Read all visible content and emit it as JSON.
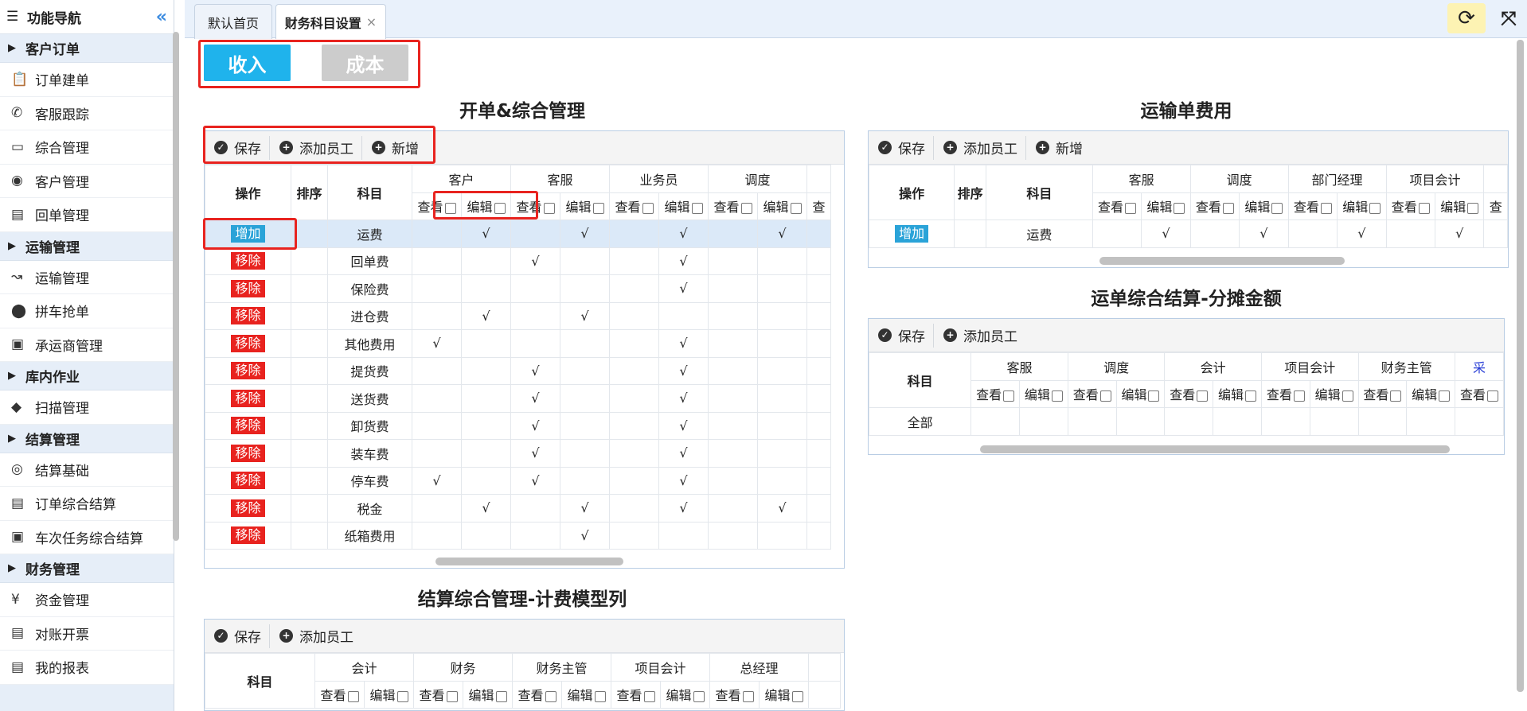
{
  "sidebar": {
    "title": "功能导航",
    "collapse_icon": "double-chevron-left-icon",
    "groups": [
      {
        "label": "客户订单",
        "items": [
          {
            "label": "订单建单",
            "icon": "clipboard-icon"
          },
          {
            "label": "客服跟踪",
            "icon": "phone-icon"
          },
          {
            "label": "综合管理",
            "icon": "monitor-icon"
          },
          {
            "label": "客户管理",
            "icon": "user-circle-icon"
          },
          {
            "label": "回单管理",
            "icon": "document-icon"
          }
        ]
      },
      {
        "label": "运输管理",
        "items": [
          {
            "label": "运输管理",
            "icon": "route-icon"
          },
          {
            "label": "拼车抢单",
            "icon": "map-pin-icon"
          },
          {
            "label": "承运商管理",
            "icon": "bus-icon"
          }
        ]
      },
      {
        "label": "库内作业",
        "items": [
          {
            "label": "扫描管理",
            "icon": "box-icon"
          }
        ]
      },
      {
        "label": "结算管理",
        "items": [
          {
            "label": "结算基础",
            "icon": "eye-icon"
          },
          {
            "label": "订单综合结算",
            "icon": "document-icon"
          },
          {
            "label": "车次任务综合结算",
            "icon": "bus-icon"
          }
        ]
      },
      {
        "label": "财务管理",
        "items": [
          {
            "label": "资金管理",
            "icon": "yen-icon"
          },
          {
            "label": "对账开票",
            "icon": "document-icon"
          },
          {
            "label": "我的报表",
            "icon": "document-icon"
          }
        ]
      }
    ]
  },
  "tabs": [
    {
      "label": "默认首页",
      "active": false
    },
    {
      "label": "财务科目设置",
      "active": true,
      "close": "×"
    }
  ],
  "toggle": {
    "income": "收入",
    "cost": "成本",
    "income_color": "#1fb3ec",
    "cost_color": "#cccccc"
  },
  "common": {
    "save": "保存",
    "add_staff": "添加员工",
    "add_new": "新增",
    "view": "查看",
    "edit": "编辑",
    "op": "操作",
    "order": "排序",
    "subject": "科目",
    "add": "增加",
    "remove": "移除",
    "check": "√"
  },
  "sec1": {
    "title": "开单&综合管理",
    "roles": [
      "客户",
      "客服",
      "业务员",
      "调度"
    ],
    "rows": [
      {
        "name": "运费",
        "cells": [
          0,
          1,
          0,
          1,
          0,
          1,
          0,
          1
        ],
        "add": true
      },
      {
        "name": "回单费",
        "cells": [
          0,
          0,
          1,
          0,
          0,
          1,
          0,
          0
        ]
      },
      {
        "name": "保险费",
        "cells": [
          0,
          0,
          0,
          0,
          0,
          1,
          0,
          0
        ]
      },
      {
        "name": "进仓费",
        "cells": [
          0,
          1,
          0,
          1,
          0,
          0,
          0,
          0
        ]
      },
      {
        "name": "其他费用",
        "cells": [
          1,
          0,
          0,
          0,
          0,
          1,
          0,
          0
        ]
      },
      {
        "name": "提货费",
        "cells": [
          0,
          0,
          1,
          0,
          0,
          1,
          0,
          0
        ]
      },
      {
        "name": "送货费",
        "cells": [
          0,
          0,
          1,
          0,
          0,
          1,
          0,
          0
        ]
      },
      {
        "name": "卸货费",
        "cells": [
          0,
          0,
          1,
          0,
          0,
          1,
          0,
          0
        ]
      },
      {
        "name": "装车费",
        "cells": [
          0,
          0,
          1,
          0,
          0,
          1,
          0,
          0
        ]
      },
      {
        "name": "停车费",
        "cells": [
          1,
          0,
          1,
          0,
          0,
          1,
          0,
          0
        ]
      },
      {
        "name": "税金",
        "cells": [
          0,
          1,
          0,
          1,
          0,
          1,
          0,
          1
        ]
      },
      {
        "name": "纸箱费用",
        "cells": [
          0,
          0,
          0,
          1,
          0,
          0,
          0,
          0
        ]
      }
    ],
    "trailing_header": "查"
  },
  "sec2": {
    "title": "运输单费用",
    "roles": [
      "客服",
      "调度",
      "部门经理",
      "项目会计"
    ],
    "rows": [
      {
        "name": "运费",
        "cells": [
          0,
          1,
          0,
          1,
          0,
          1,
          0,
          1
        ],
        "add": true
      }
    ],
    "trailing_header": "查"
  },
  "sec3": {
    "title": "运单综合结算-分摊金额",
    "roles": [
      "客服",
      "调度",
      "会计",
      "项目会计",
      "财务主管"
    ],
    "rows": [
      {
        "name": "全部"
      }
    ],
    "trailing_header": "查看",
    "trailing_role": "采"
  },
  "sec4": {
    "title": "结算综合管理-计费模型列",
    "roles": [
      "会计",
      "财务",
      "财务主管",
      "项目会计",
      "总经理"
    ]
  }
}
